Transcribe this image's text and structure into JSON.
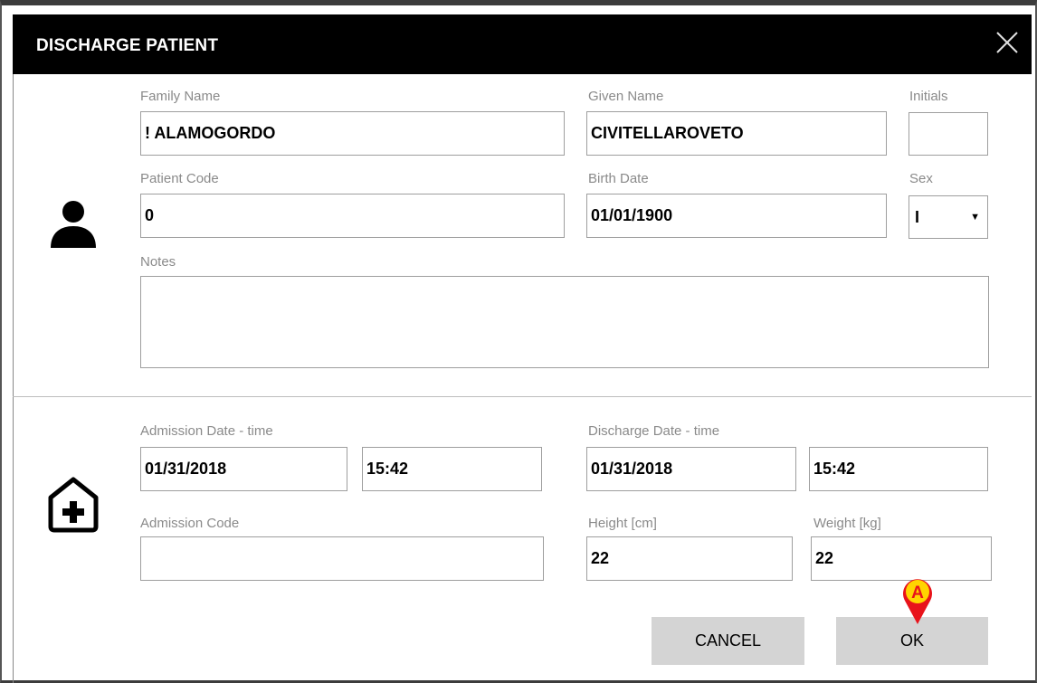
{
  "dialog": {
    "title": "DISCHARGE PATIENT",
    "close_icon": "close-icon"
  },
  "patient": {
    "icon": "person-icon",
    "family_name": {
      "label": "Family Name",
      "value": "! ALAMOGORDO"
    },
    "given_name": {
      "label": "Given Name",
      "value": "CIVITELLAROVETO"
    },
    "initials": {
      "label": "Initials",
      "value": ""
    },
    "patient_code": {
      "label": "Patient Code",
      "value": "0"
    },
    "birth_date": {
      "label": "Birth Date",
      "value": "01/01/1900"
    },
    "sex": {
      "label": "Sex",
      "value": "I"
    },
    "notes": {
      "label": "Notes",
      "value": ""
    }
  },
  "admission": {
    "icon": "hospital-icon",
    "admission_datetime": {
      "label": "Admission Date - time",
      "date": "01/31/2018",
      "time": "15:42"
    },
    "discharge_datetime": {
      "label": "Discharge Date - time",
      "date": "01/31/2018",
      "time": "15:42"
    },
    "admission_code": {
      "label": "Admission Code",
      "value": ""
    },
    "height": {
      "label": "Height [cm]",
      "value": "22"
    },
    "weight": {
      "label": "Weight [kg]",
      "value": "22"
    }
  },
  "actions": {
    "cancel_label": "CANCEL",
    "ok_label": "OK"
  },
  "annotation": {
    "marker_label": "A",
    "marker_color": "#e8131b",
    "marker_fill": "#ffd400"
  }
}
